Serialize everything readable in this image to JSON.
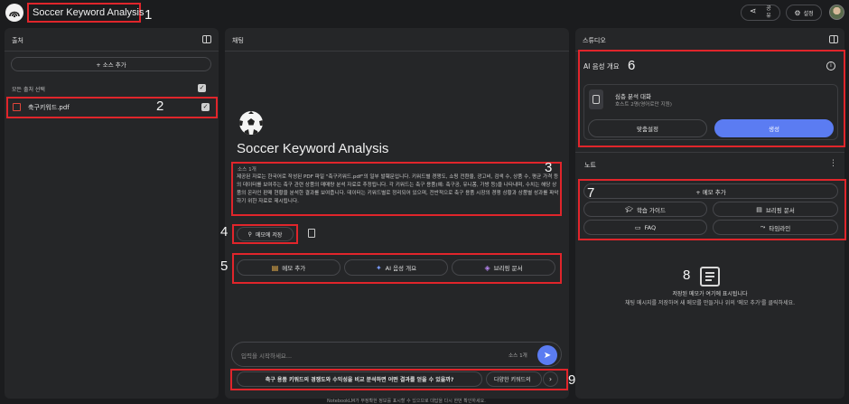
{
  "app": {
    "title": "Soccer Keyword Analysis"
  },
  "topbar": {
    "share_label": "공유",
    "settings_label": "설정"
  },
  "sources": {
    "header": "출처",
    "add_button": "+ 소스 추가",
    "select_all": "모든 출처 선택",
    "items": [
      {
        "name": "축구키워드.pdf",
        "checked": true
      }
    ]
  },
  "chat": {
    "header": "채팅",
    "title": "Soccer Keyword Analysis",
    "source_count": "소스 1개",
    "summary": "제공된 자료는 한국어로 작성된 PDF 파일 \"축구키워드.pdf\"의 일부 발췌문입니다. 키워드별 경쟁도, 쇼핑 전환율, 광고비, 검색 수, 상품 수, 평균 가격 등의 데이터를 보여주는 축구 관련 상품의 매매량 분석 자료로 추정됩니다. 각 키워드는 축구 용품(예: 축구공, 유니폼, 가방 등)을 나타내며, 수치는 해당 상품의 온라인 판매 현황을 분석한 결과를 보여줍니다. 데이터는 키워드별로 정리되어 있으며, 전반적으로 축구 용품 시장의 경쟁 상황과 상품별 성과를 파악하기 위한 자료로 제시됩니다.",
    "save_to_note": "메모에 저장",
    "action_buttons": [
      {
        "label": "메모 추가",
        "icon": "note-add-icon",
        "color": "#f2b64b"
      },
      {
        "label": "AI 음성 개요",
        "icon": "sparkle-icon",
        "color": "#7a9bff"
      },
      {
        "label": "브리핑 문서",
        "icon": "layers-icon",
        "color": "#b785f0"
      }
    ],
    "input_placeholder": "입력을 시작하세요...",
    "input_source_count": "소스 1개",
    "suggestions": [
      "축구 용품 키워드의 경쟁도와 수익성을 비교 분석하면 어떤 결과를 얻을 수 있을까?",
      "다양한 키워드의"
    ],
    "footer": "NotebookLM가 부정확한 정보를 표시할 수 있으므로 대답을 다시 한번 확인하세요."
  },
  "studio": {
    "header": "스튜디오",
    "audio_overview": {
      "title": "AI 음성 개요",
      "item_title": "심층 분석 대화",
      "item_subtitle": "호스트 2명(영어로만 지원)",
      "customize": "맞춤설정",
      "generate": "생성"
    },
    "notes": {
      "header": "노트",
      "add_note": "+ 메모 추가",
      "buttons": [
        {
          "label": "학습 가이드",
          "icon": "graduation-cap-icon"
        },
        {
          "label": "브리핑 문서",
          "icon": "document-icon"
        },
        {
          "label": "FAQ",
          "icon": "faq-icon"
        },
        {
          "label": "타임라인",
          "icon": "timeline-icon"
        }
      ],
      "empty_title": "저장된 메모가 여기에 표시됩니다",
      "empty_body": "채팅 메시지를 저장하여 새 메모를 만들거나 위의 '메모 추가'를 클릭하세요."
    }
  },
  "annotations": [
    "1",
    "2",
    "3",
    "4",
    "5",
    "6",
    "7",
    "8",
    "9"
  ]
}
